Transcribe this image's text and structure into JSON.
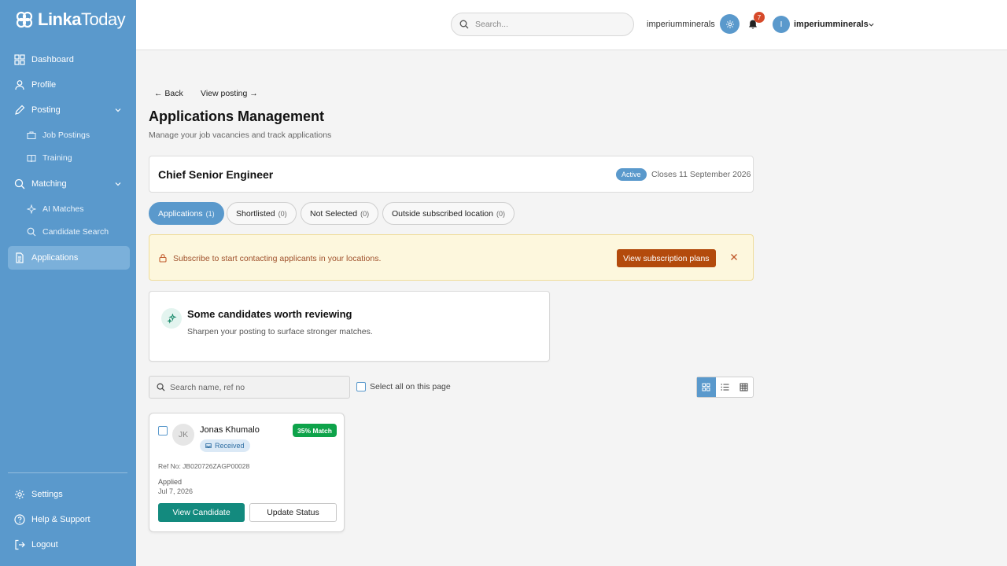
{
  "brand": {
    "logo_text_a": "Linka",
    "logo_text_b": "Today"
  },
  "sidebar": {
    "items": [
      {
        "label": "Dashboard"
      },
      {
        "label": "Profile"
      },
      {
        "label": "Posting"
      },
      {
        "label": "Job Postings"
      },
      {
        "label": "Training"
      },
      {
        "label": "Matching"
      },
      {
        "label": "AI Matches"
      },
      {
        "label": "Candidate Search"
      },
      {
        "label": "Applications"
      }
    ],
    "bottom": [
      {
        "label": "Settings"
      },
      {
        "label": "Help & Support"
      },
      {
        "label": "Logout"
      }
    ]
  },
  "topbar": {
    "search_placeholder": "Search...",
    "org_name": "imperiumminerals",
    "notification_count": "7",
    "user_initial": "I",
    "user_name": "imperiumminerals"
  },
  "nav": {
    "back": "← Back",
    "view_posting": "View posting →"
  },
  "page": {
    "title": "Applications Management",
    "subtitle": "Manage your job vacancies and track applications"
  },
  "posting": {
    "title": "Chief Senior Engineer",
    "status": "Active",
    "closes": "Closes 11 September 2026"
  },
  "tabs": [
    {
      "label": "Applications",
      "count": "(1)"
    },
    {
      "label": "Shortlisted",
      "count": "(0)"
    },
    {
      "label": "Not Selected",
      "count": "(0)"
    },
    {
      "label": "Outside subscribed location",
      "count": "(0)"
    }
  ],
  "alert": {
    "text": "Subscribe to start contacting applicants in your locations.",
    "button": "View subscription plans"
  },
  "suggestion": {
    "title": "Some candidates worth reviewing",
    "subtitle": "Sharpen your posting to surface stronger matches."
  },
  "list": {
    "search_placeholder": "Search name, ref no",
    "select_all": "Select all on this page"
  },
  "candidate": {
    "initials": "JK",
    "name": "Jonas Khumalo",
    "match": "35% Match",
    "status": "Received",
    "ref": "Ref No: JB020726ZAGP00028",
    "applied_label": "Applied",
    "applied_date": "Jul 7, 2026",
    "view_button": "View Candidate",
    "update_button": "Update Status"
  },
  "colors": {
    "sidebar": "#5a99cc",
    "accent": "#5a99cc",
    "alert_button": "#b34a0c",
    "match_badge": "#0ea34a",
    "view_button": "#138a7e"
  }
}
